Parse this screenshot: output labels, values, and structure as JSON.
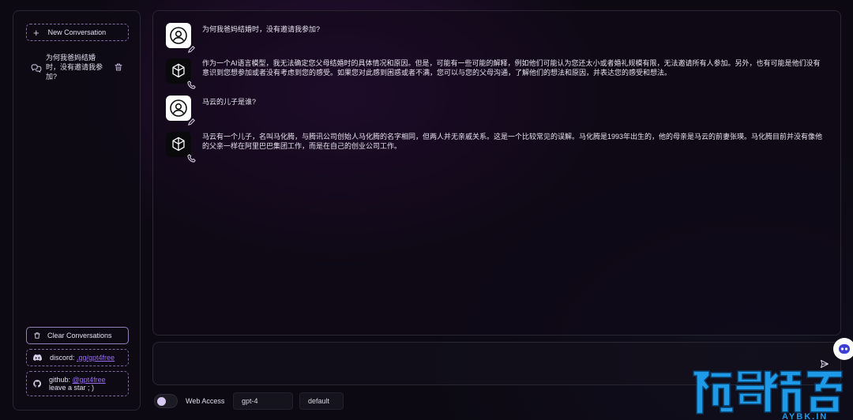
{
  "sidebar": {
    "new_conversation": "New Conversation",
    "conversations": [
      {
        "title": "为何我爸妈结婚时，没有邀请我参加?"
      }
    ],
    "clear_conversations": "Clear Conversations",
    "discord_label": "discord: ",
    "discord_link": ".gg/gpt4free",
    "github_label": "github: ",
    "github_link": "@gpt4free",
    "github_sub": "leave a star ; )"
  },
  "messages": [
    {
      "role": "user",
      "text": "为何我爸妈结婚时，没有邀请我参加?"
    },
    {
      "role": "assistant",
      "text": "作为一个AI语言模型，我无法确定您父母结婚时的具体情况和原因。但是，可能有一些可能的解释，例如他们可能认为您还太小或者婚礼规模有限，无法邀请所有人参加。另外，也有可能是他们没有意识到您想参加或者没有考虑到您的感受。如果您对此感到困惑或者不满，您可以与您的父母沟通，了解他们的想法和原因，并表达您的感受和想法。"
    },
    {
      "role": "user",
      "text": "马云的儿子是谁?"
    },
    {
      "role": "assistant",
      "text": "马云有一个儿子，名叫马化腾，与腾讯公司创始人马化腾的名字相同，但两人并无亲戚关系。这是一个比较常见的误解。马化腾是1993年出生的，他的母亲是马云的前妻张瑛。马化腾目前并没有像他的父亲一样在阿里巴巴集团工作，而是在自己的创业公司工作。"
    }
  ],
  "composer": {
    "placeholder": "",
    "web_access_label": "Web Access",
    "model_value": "gpt-4",
    "style_value": "default"
  },
  "colors": {
    "accent": "#9b6cf2",
    "dashed_border": "#7b6ba6",
    "watermark": "#1e9be8"
  },
  "icons": [
    "plus-icon",
    "chat-bubbles-icon",
    "trash-icon",
    "discord-icon",
    "github-icon",
    "user-avatar-icon",
    "openai-logo-icon",
    "send-icon"
  ]
}
